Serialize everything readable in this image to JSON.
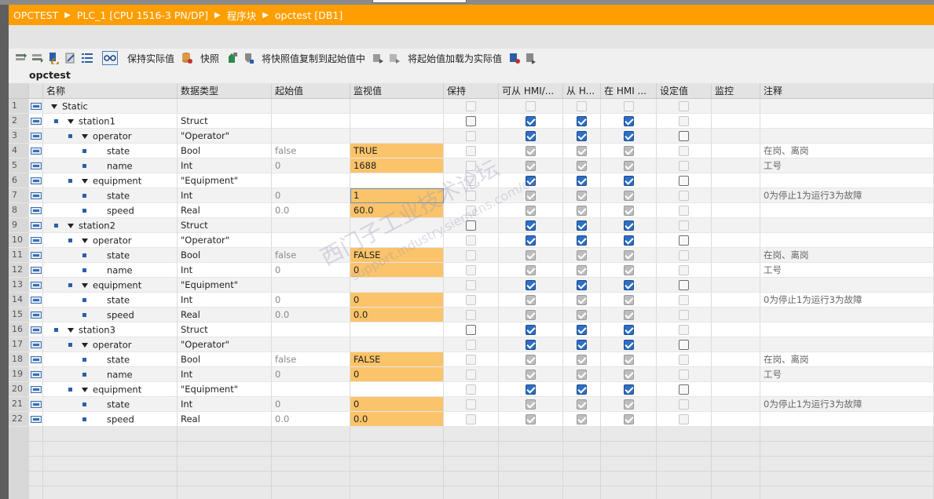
{
  "breadcrumb": [
    "OPCTEST",
    "PLC_1 [CPU 1516-3 PN/DP]",
    "程序块",
    "opctest [DB1]"
  ],
  "breadcrumb_sep": "▶",
  "toolbar": {
    "keep_actual": "保持实际值",
    "snapshot": "快照",
    "copy_snapshot": "将快照值复制到起始值中",
    "load_start": "将起始值加载为实际值"
  },
  "db_title": "opctest",
  "columns": {
    "name": "名称",
    "type": "数据类型",
    "start": "起始值",
    "monitor": "监视值",
    "retain": "保持",
    "hmi_access": "可从 HMI/...",
    "hmi_write": "从 H...",
    "hmi_visible": "在 HMI ...",
    "setpoint": "设定值",
    "watch": "监控",
    "comment": "注释"
  },
  "rows": [
    {
      "n": "1",
      "name": "Static",
      "type": "",
      "start": "",
      "mon": "",
      "comment": "",
      "level": 0,
      "tri": true,
      "bullet": false,
      "hl": false,
      "cbs": [
        "off",
        "off",
        "off",
        "off",
        "off"
      ]
    },
    {
      "n": "2",
      "name": "station1",
      "type": "Struct",
      "start": "",
      "mon": "",
      "comment": "",
      "level": 1,
      "tri": true,
      "bullet": true,
      "hl": false,
      "cbs": [
        "dark",
        "on",
        "on",
        "on",
        "off"
      ]
    },
    {
      "n": "3",
      "name": "operator",
      "type": "\"Operator\"",
      "start": "",
      "mon": "",
      "comment": "",
      "level": 2,
      "tri": true,
      "bullet": true,
      "hl": false,
      "cbs": [
        "off",
        "on",
        "on",
        "on",
        "dark"
      ]
    },
    {
      "n": "4",
      "name": "state",
      "type": "Bool",
      "start": "false",
      "mon": "TRUE",
      "comment": "在岗、离岗",
      "level": 3,
      "tri": false,
      "bullet": true,
      "hl": true,
      "cbs": [
        "off",
        "grey",
        "grey",
        "grey",
        "off"
      ]
    },
    {
      "n": "5",
      "name": "name",
      "type": "Int",
      "start": "0",
      "mon": "1688",
      "comment": "工号",
      "level": 3,
      "tri": false,
      "bullet": true,
      "hl": true,
      "cbs": [
        "off",
        "grey",
        "grey",
        "grey",
        "off"
      ]
    },
    {
      "n": "6",
      "name": "equipment",
      "type": "\"Equipment\"",
      "start": "",
      "mon": "",
      "comment": "",
      "level": 2,
      "tri": true,
      "bullet": true,
      "hl": false,
      "cbs": [
        "off",
        "on",
        "on",
        "on",
        "dark"
      ]
    },
    {
      "n": "7",
      "name": "state",
      "type": "Int",
      "start": "0",
      "mon": "1",
      "comment": "0为停止1为运行3为故障",
      "level": 3,
      "tri": false,
      "bullet": true,
      "hl": "sel",
      "cbs": [
        "off",
        "grey",
        "grey",
        "grey",
        "off"
      ]
    },
    {
      "n": "8",
      "name": "speed",
      "type": "Real",
      "start": "0.0",
      "mon": "60.0",
      "comment": "",
      "level": 3,
      "tri": false,
      "bullet": true,
      "hl": true,
      "cbs": [
        "off",
        "grey",
        "grey",
        "grey",
        "off"
      ]
    },
    {
      "n": "9",
      "name": "station2",
      "type": "Struct",
      "start": "",
      "mon": "",
      "comment": "",
      "level": 1,
      "tri": true,
      "bullet": true,
      "hl": false,
      "cbs": [
        "dark",
        "on",
        "on",
        "on",
        "off"
      ]
    },
    {
      "n": "10",
      "name": "operator",
      "type": "\"Operator\"",
      "start": "",
      "mon": "",
      "comment": "",
      "level": 2,
      "tri": true,
      "bullet": true,
      "hl": false,
      "cbs": [
        "off",
        "on",
        "on",
        "on",
        "dark"
      ]
    },
    {
      "n": "11",
      "name": "state",
      "type": "Bool",
      "start": "false",
      "mon": "FALSE",
      "comment": "在岗、离岗",
      "level": 3,
      "tri": false,
      "bullet": true,
      "hl": true,
      "cbs": [
        "off",
        "grey",
        "grey",
        "grey",
        "off"
      ]
    },
    {
      "n": "12",
      "name": "name",
      "type": "Int",
      "start": "0",
      "mon": "0",
      "comment": "工号",
      "level": 3,
      "tri": false,
      "bullet": true,
      "hl": true,
      "cbs": [
        "off",
        "grey",
        "grey",
        "grey",
        "off"
      ]
    },
    {
      "n": "13",
      "name": "equipment",
      "type": "\"Equipment\"",
      "start": "",
      "mon": "",
      "comment": "",
      "level": 2,
      "tri": true,
      "bullet": true,
      "hl": false,
      "cbs": [
        "off",
        "on",
        "on",
        "on",
        "dark"
      ]
    },
    {
      "n": "14",
      "name": "state",
      "type": "Int",
      "start": "0",
      "mon": "0",
      "comment": "0为停止1为运行3为故障",
      "level": 3,
      "tri": false,
      "bullet": true,
      "hl": true,
      "cbs": [
        "off",
        "grey",
        "grey",
        "grey",
        "off"
      ]
    },
    {
      "n": "15",
      "name": "speed",
      "type": "Real",
      "start": "0.0",
      "mon": "0.0",
      "comment": "",
      "level": 3,
      "tri": false,
      "bullet": true,
      "hl": true,
      "cbs": [
        "off",
        "grey",
        "grey",
        "grey",
        "off"
      ]
    },
    {
      "n": "16",
      "name": "station3",
      "type": "Struct",
      "start": "",
      "mon": "",
      "comment": "",
      "level": 1,
      "tri": true,
      "bullet": true,
      "hl": false,
      "cbs": [
        "dark",
        "on",
        "on",
        "on",
        "off"
      ]
    },
    {
      "n": "17",
      "name": "operator",
      "type": "\"Operator\"",
      "start": "",
      "mon": "",
      "comment": "",
      "level": 2,
      "tri": true,
      "bullet": true,
      "hl": false,
      "cbs": [
        "off",
        "on",
        "on",
        "on",
        "dark"
      ]
    },
    {
      "n": "18",
      "name": "state",
      "type": "Bool",
      "start": "false",
      "mon": "FALSE",
      "comment": "在岗、离岗",
      "level": 3,
      "tri": false,
      "bullet": true,
      "hl": true,
      "cbs": [
        "off",
        "grey",
        "grey",
        "grey",
        "off"
      ]
    },
    {
      "n": "19",
      "name": "name",
      "type": "Int",
      "start": "0",
      "mon": "0",
      "comment": "工号",
      "level": 3,
      "tri": false,
      "bullet": true,
      "hl": true,
      "cbs": [
        "off",
        "grey",
        "grey",
        "grey",
        "off"
      ]
    },
    {
      "n": "20",
      "name": "equipment",
      "type": "\"Equipment\"",
      "start": "",
      "mon": "",
      "comment": "",
      "level": 2,
      "tri": true,
      "bullet": true,
      "hl": false,
      "cbs": [
        "off",
        "on",
        "on",
        "on",
        "dark"
      ]
    },
    {
      "n": "21",
      "name": "state",
      "type": "Int",
      "start": "0",
      "mon": "0",
      "comment": "0为停止1为运行3为故障",
      "level": 3,
      "tri": false,
      "bullet": true,
      "hl": true,
      "cbs": [
        "off",
        "grey",
        "grey",
        "grey",
        "off"
      ]
    },
    {
      "n": "22",
      "name": "speed",
      "type": "Real",
      "start": "0.0",
      "mon": "0.0",
      "comment": "",
      "level": 3,
      "tri": false,
      "bullet": true,
      "hl": true,
      "cbs": [
        "off",
        "grey",
        "grey",
        "grey",
        "off"
      ]
    }
  ],
  "empty_rows": 5,
  "watermark": {
    "line1": "西门子工业技术论坛",
    "line2": "support.industry.siemens.com/cs"
  },
  "colors": {
    "title_bar": "#ff9e00",
    "monitor_highlight": "#fbc46a",
    "checkbox_on": "#2c6fc6"
  }
}
